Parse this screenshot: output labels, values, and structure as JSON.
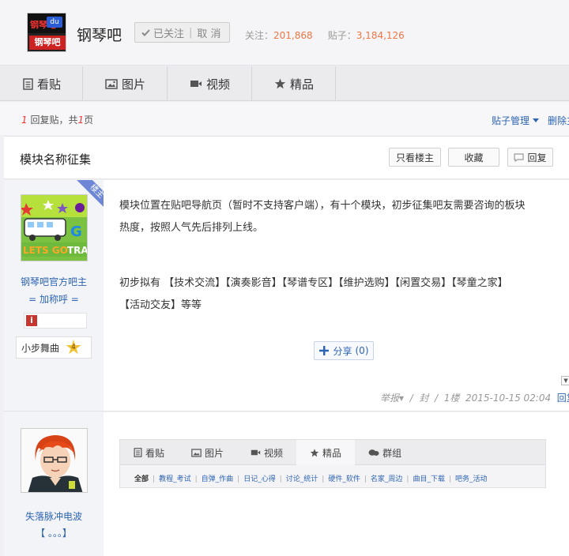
{
  "header": {
    "forum_name": "钢琴吧",
    "follow_label": "已关注",
    "cancel_label": "取 消",
    "follow_stat_label": "关注：",
    "follow_count": "201,868",
    "post_stat_label": "贴子：",
    "post_count": "3,184,126",
    "logo_text_top": "钢琴吧",
    "logo_text_bottom": "钢琴吧"
  },
  "nav": {
    "tabs": [
      {
        "label": "看贴",
        "icon": "doc-icon"
      },
      {
        "label": "图片",
        "icon": "image-icon"
      },
      {
        "label": "视频",
        "icon": "video-icon"
      },
      {
        "label": "精品",
        "icon": "star-icon"
      }
    ]
  },
  "bar": {
    "reply_num": "1",
    "reply_text": "回复贴，共",
    "page_num": "1",
    "page_unit": "页",
    "manage_label": "贴子管理",
    "delete_label": "删除主"
  },
  "thread": {
    "title": "模块名称征集",
    "only_author": "只看楼主",
    "favorite": "收藏",
    "reply": "回复"
  },
  "post1": {
    "badge": "楼主",
    "author": "钢琴吧官方吧主",
    "author_title": "= 加称呼 =",
    "level_name": "小步舞曲",
    "level": "4",
    "content_p1_line1": "模块位置在贴吧导航页（暂时不支持客户端），有十个模块，初步征集吧友需要咨询的板块",
    "content_p1_line2": "热度，按照人气先后排列上线。",
    "content_p2_line1": "初步拟有 【技术交流】【演奏影音】【琴谱专区】【维护选购】【闲置交易】【琴童之家】",
    "content_p2_line2": "【活动交友】等等",
    "share_label": "分享",
    "share_count": "(0)",
    "report": "举报",
    "seal": "封",
    "floor": "1楼",
    "date": "2015-10-15 02:04",
    "reply": "回复"
  },
  "post2": {
    "author": "失落脉冲电波",
    "author_title": "【 。。。】",
    "mini_tabs": [
      {
        "label": "看贴",
        "icon": "doc-icon"
      },
      {
        "label": "图片",
        "icon": "image-icon"
      },
      {
        "label": "视频",
        "icon": "video-icon"
      },
      {
        "label": "精品",
        "icon": "star-icon"
      },
      {
        "label": "群组",
        "icon": "group-icon"
      }
    ],
    "mini_links": [
      "全部",
      "教程_考试",
      "自弹_作曲",
      "日记_心得",
      "讨论_统计",
      "硬件_软件",
      "名家_周边",
      "曲目_下载",
      "吧务_活动"
    ]
  },
  "colors": {
    "link": "#2d64b3",
    "accent_orange": "#ee7744",
    "badge": "#6d87d6"
  }
}
